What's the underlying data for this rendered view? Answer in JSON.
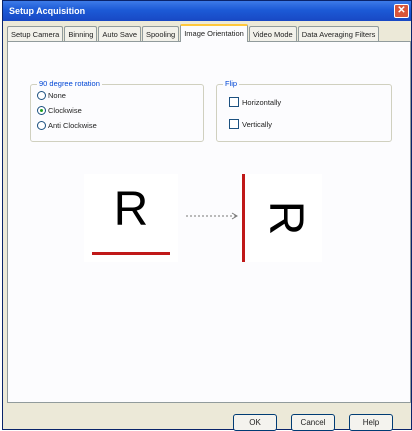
{
  "window": {
    "title": "Setup Acquisition",
    "close_symbol": "✕"
  },
  "tabs": [
    {
      "label": "Setup Camera",
      "active": false
    },
    {
      "label": "Binning",
      "active": false
    },
    {
      "label": "Auto Save",
      "active": false
    },
    {
      "label": "Spooling",
      "active": false
    },
    {
      "label": "Image Orientation",
      "active": true
    },
    {
      "label": "Video Mode",
      "active": false
    },
    {
      "label": "Data Averaging Filters",
      "active": false
    }
  ],
  "rotation": {
    "title": "90 degree rotation",
    "options": [
      {
        "label": "None",
        "checked": false
      },
      {
        "label": "Clockwise",
        "checked": true
      },
      {
        "label": "Anti Clockwise",
        "checked": false
      }
    ]
  },
  "flip": {
    "title": "Flip",
    "options": [
      {
        "label": "Horizontally",
        "checked": false
      },
      {
        "label": "Vertically",
        "checked": false
      }
    ]
  },
  "preview": {
    "original_letter": "R",
    "rotated_letter": "R",
    "arrow_symbol": "→",
    "marker_color": "#c01818"
  },
  "buttons": {
    "ok": "OK",
    "cancel": "Cancel",
    "help": "Help"
  }
}
